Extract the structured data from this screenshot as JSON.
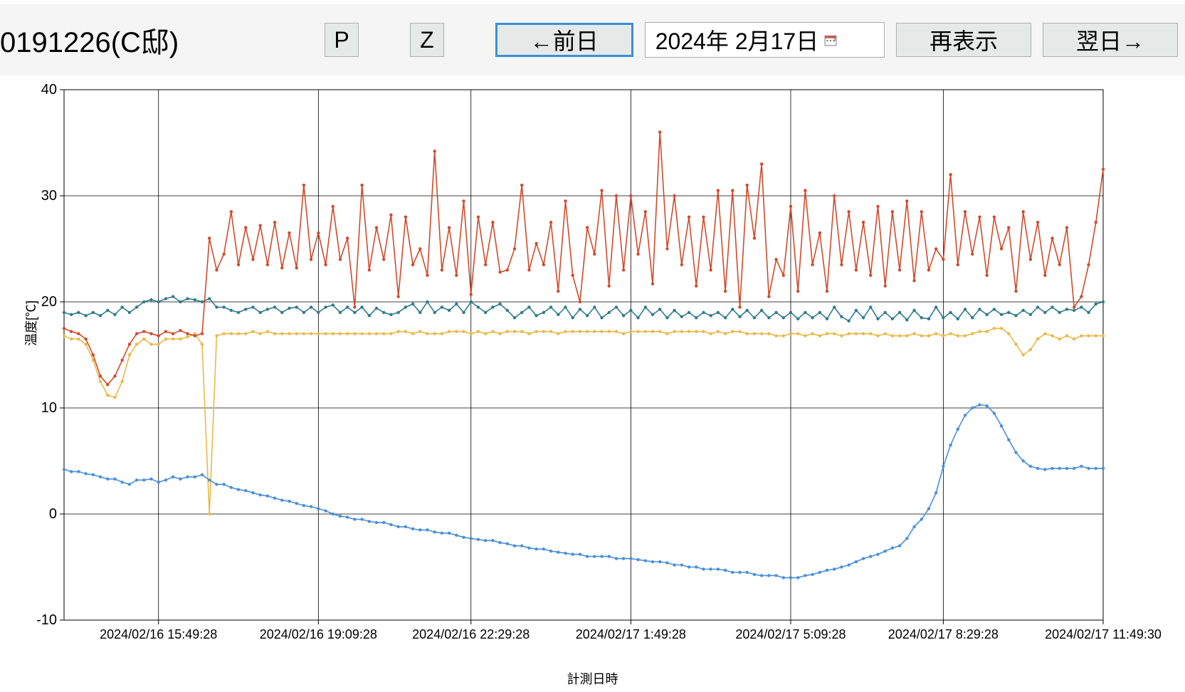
{
  "header": {
    "title": "0191226(C邸)",
    "btn_p": "P",
    "btn_z": "Z",
    "btn_prev": "←前日",
    "date_value": "2024年 2月17日",
    "btn_refresh": "再表示",
    "btn_next": "翌日→"
  },
  "chart_data": {
    "type": "line",
    "title": "",
    "xlabel": "計測日時",
    "ylabel": "温度[℃]",
    "ylim": [
      -10,
      40
    ],
    "yticks": [
      -10,
      0,
      10,
      20,
      30,
      40
    ],
    "xticks": [
      "2024/02/16 15:49:28",
      "2024/02/16 19:09:28",
      "2024/02/16 22:29:28",
      "2024/02/17 1:49:28",
      "2024/02/17 5:09:28",
      "2024/02/17 8:29:28",
      "2024/02/17 11:49:30"
    ],
    "n_points": 144,
    "colors": {
      "red": "#cf4b2c",
      "teal": "#2f7b8c",
      "yellow": "#e9b949",
      "blue": "#4a8fd9"
    },
    "series": [
      {
        "name": "red",
        "values": [
          17.5,
          17.2,
          17.0,
          16.5,
          15.0,
          13.0,
          12.2,
          13.0,
          14.5,
          16.0,
          17.0,
          17.2,
          17.0,
          16.8,
          17.2,
          17.0,
          17.3,
          17.0,
          16.8,
          17.0,
          26.0,
          23.0,
          24.5,
          28.5,
          23.5,
          27.0,
          24.0,
          27.2,
          23.5,
          27.5,
          23.2,
          26.5,
          23.2,
          31.0,
          24.0,
          26.5,
          23.5,
          29.0,
          24.0,
          26.0,
          19.5,
          31.0,
          23.0,
          27.0,
          24.0,
          28.2,
          20.5,
          28.0,
          23.5,
          25.0,
          22.5,
          34.2,
          23.0,
          27.0,
          22.5,
          29.5,
          20.7,
          28.0,
          23.5,
          27.5,
          22.8,
          23.0,
          25.0,
          31.0,
          23.0,
          25.5,
          23.5,
          27.5,
          21.0,
          29.5,
          22.5,
          20.0,
          27.0,
          24.5,
          30.5,
          21.5,
          30.0,
          23.0,
          30.0,
          24.5,
          28.5,
          21.7,
          36.0,
          25.0,
          30.0,
          23.5,
          28.0,
          21.5,
          28.0,
          23.0,
          30.5,
          21.0,
          30.5,
          19.5,
          31.0,
          26.0,
          33.0,
          20.5,
          24.0,
          22.5,
          29.0,
          21.0,
          30.5,
          23.5,
          26.5,
          21.0,
          30.0,
          23.5,
          28.5,
          23.0,
          27.5,
          22.5,
          29.0,
          21.5,
          28.5,
          23.0,
          29.5,
          22.0,
          28.5,
          23.0,
          25.0,
          24.0,
          32.0,
          23.5,
          28.5,
          24.5,
          28.0,
          22.5,
          28.0,
          25.0,
          27.0,
          21.0,
          28.5,
          24.0,
          27.5,
          22.5,
          26.0,
          23.5,
          27.0,
          19.5,
          20.5,
          23.5,
          27.5,
          32.5
        ]
      },
      {
        "name": "teal",
        "values": [
          19.0,
          18.8,
          19.0,
          18.7,
          19.0,
          18.7,
          19.2,
          18.8,
          19.5,
          19.0,
          19.5,
          20.0,
          20.2,
          20.0,
          20.3,
          20.5,
          20.0,
          20.3,
          20.2,
          20.0,
          20.3,
          19.5,
          19.5,
          19.2,
          19.0,
          19.3,
          19.5,
          19.0,
          19.3,
          19.5,
          19.0,
          19.4,
          19.5,
          19.0,
          19.5,
          19.0,
          19.5,
          19.7,
          19.0,
          19.5,
          19.0,
          19.5,
          18.7,
          19.4,
          19.0,
          18.8,
          19.0,
          19.5,
          19.8,
          19.0,
          20.0,
          19.0,
          19.5,
          19.2,
          19.8,
          19.0,
          20.0,
          19.5,
          19.0,
          19.5,
          19.8,
          19.2,
          18.5,
          19.0,
          19.5,
          18.7,
          19.0,
          19.5,
          18.8,
          19.5,
          18.5,
          19.3,
          18.7,
          19.5,
          18.5,
          19.0,
          19.5,
          18.7,
          19.2,
          18.5,
          19.5,
          18.8,
          19.3,
          18.5,
          19.2,
          18.6,
          19.0,
          18.5,
          19.0,
          18.7,
          19.0,
          18.5,
          19.3,
          18.6,
          19.2,
          18.5,
          19.2,
          18.5,
          19.0,
          18.5,
          19.0,
          18.4,
          19.0,
          18.5,
          19.0,
          18.4,
          19.5,
          18.6,
          18.2,
          19.2,
          18.5,
          19.5,
          18.4,
          19.0,
          18.4,
          19.0,
          18.3,
          19.2,
          18.5,
          18.4,
          19.5,
          18.5,
          19.0,
          18.4,
          19.3,
          18.5,
          19.3,
          18.8,
          19.3,
          18.8,
          19.0,
          18.7,
          19.2,
          18.8,
          19.5,
          19.0,
          19.5,
          19.0,
          19.3,
          19.2,
          19.5,
          19.0,
          19.8,
          20.0
        ]
      },
      {
        "name": "yellow",
        "values": [
          16.8,
          16.5,
          16.5,
          16.0,
          14.5,
          12.5,
          11.2,
          11.0,
          12.5,
          15.0,
          16.0,
          16.5,
          16.0,
          16.0,
          16.5,
          16.5,
          16.5,
          16.7,
          17.0,
          16.0,
          0.0,
          16.8,
          17.0,
          17.0,
          17.0,
          17.0,
          17.2,
          17.0,
          17.2,
          17.0,
          17.0,
          17.0,
          17.0,
          17.0,
          17.0,
          17.0,
          17.0,
          17.0,
          17.0,
          17.0,
          17.0,
          17.0,
          17.0,
          17.0,
          17.0,
          17.0,
          17.2,
          17.2,
          17.0,
          17.2,
          17.0,
          17.0,
          17.0,
          17.2,
          17.2,
          17.2,
          17.0,
          17.2,
          17.0,
          17.2,
          17.0,
          17.2,
          17.2,
          17.2,
          17.0,
          17.2,
          17.2,
          17.2,
          17.0,
          17.2,
          17.2,
          17.2,
          17.2,
          17.2,
          17.2,
          17.2,
          17.2,
          17.0,
          17.2,
          17.2,
          17.2,
          17.2,
          17.2,
          17.0,
          17.2,
          17.2,
          17.2,
          17.2,
          17.2,
          17.0,
          17.2,
          17.0,
          17.2,
          17.2,
          17.0,
          17.0,
          17.0,
          17.0,
          16.8,
          16.8,
          17.0,
          17.0,
          16.8,
          17.0,
          16.8,
          17.0,
          17.0,
          16.8,
          17.0,
          17.0,
          17.0,
          17.0,
          16.8,
          17.0,
          16.8,
          16.8,
          16.8,
          17.0,
          16.8,
          16.8,
          17.0,
          16.8,
          17.0,
          16.8,
          16.8,
          17.0,
          17.2,
          17.2,
          17.5,
          17.5,
          17.0,
          16.0,
          15.0,
          15.5,
          16.5,
          17.0,
          16.8,
          16.5,
          16.8,
          16.5,
          16.8,
          16.8,
          16.8,
          16.8
        ]
      },
      {
        "name": "blue",
        "values": [
          4.2,
          4.0,
          4.0,
          3.8,
          3.7,
          3.5,
          3.3,
          3.3,
          3.0,
          2.8,
          3.2,
          3.2,
          3.3,
          3.0,
          3.2,
          3.5,
          3.3,
          3.5,
          3.5,
          3.7,
          3.2,
          2.8,
          2.8,
          2.5,
          2.3,
          2.2,
          2.0,
          1.8,
          1.7,
          1.5,
          1.3,
          1.2,
          1.0,
          0.8,
          0.7,
          0.5,
          0.3,
          0.0,
          -0.2,
          -0.3,
          -0.5,
          -0.5,
          -0.7,
          -0.8,
          -0.8,
          -1.0,
          -1.2,
          -1.2,
          -1.4,
          -1.5,
          -1.5,
          -1.7,
          -1.8,
          -1.8,
          -2.0,
          -2.2,
          -2.3,
          -2.4,
          -2.5,
          -2.5,
          -2.7,
          -2.8,
          -3.0,
          -3.0,
          -3.2,
          -3.3,
          -3.3,
          -3.5,
          -3.6,
          -3.7,
          -3.8,
          -3.8,
          -4.0,
          -4.0,
          -4.0,
          -4.0,
          -4.2,
          -4.2,
          -4.2,
          -4.3,
          -4.4,
          -4.5,
          -4.5,
          -4.6,
          -4.8,
          -4.8,
          -5.0,
          -5.0,
          -5.2,
          -5.2,
          -5.2,
          -5.3,
          -5.5,
          -5.5,
          -5.5,
          -5.7,
          -5.8,
          -5.8,
          -5.8,
          -6.0,
          -6.0,
          -6.0,
          -5.8,
          -5.7,
          -5.5,
          -5.3,
          -5.2,
          -5.0,
          -4.8,
          -4.5,
          -4.2,
          -4.0,
          -3.8,
          -3.5,
          -3.2,
          -3.0,
          -2.3,
          -1.2,
          -0.5,
          0.5,
          2.0,
          4.5,
          6.5,
          8.0,
          9.3,
          10.0,
          10.3,
          10.2,
          9.5,
          8.3,
          7.0,
          5.8,
          5.0,
          4.5,
          4.3,
          4.2,
          4.3,
          4.3,
          4.3,
          4.3,
          4.5,
          4.3,
          4.3,
          4.3
        ]
      }
    ]
  }
}
